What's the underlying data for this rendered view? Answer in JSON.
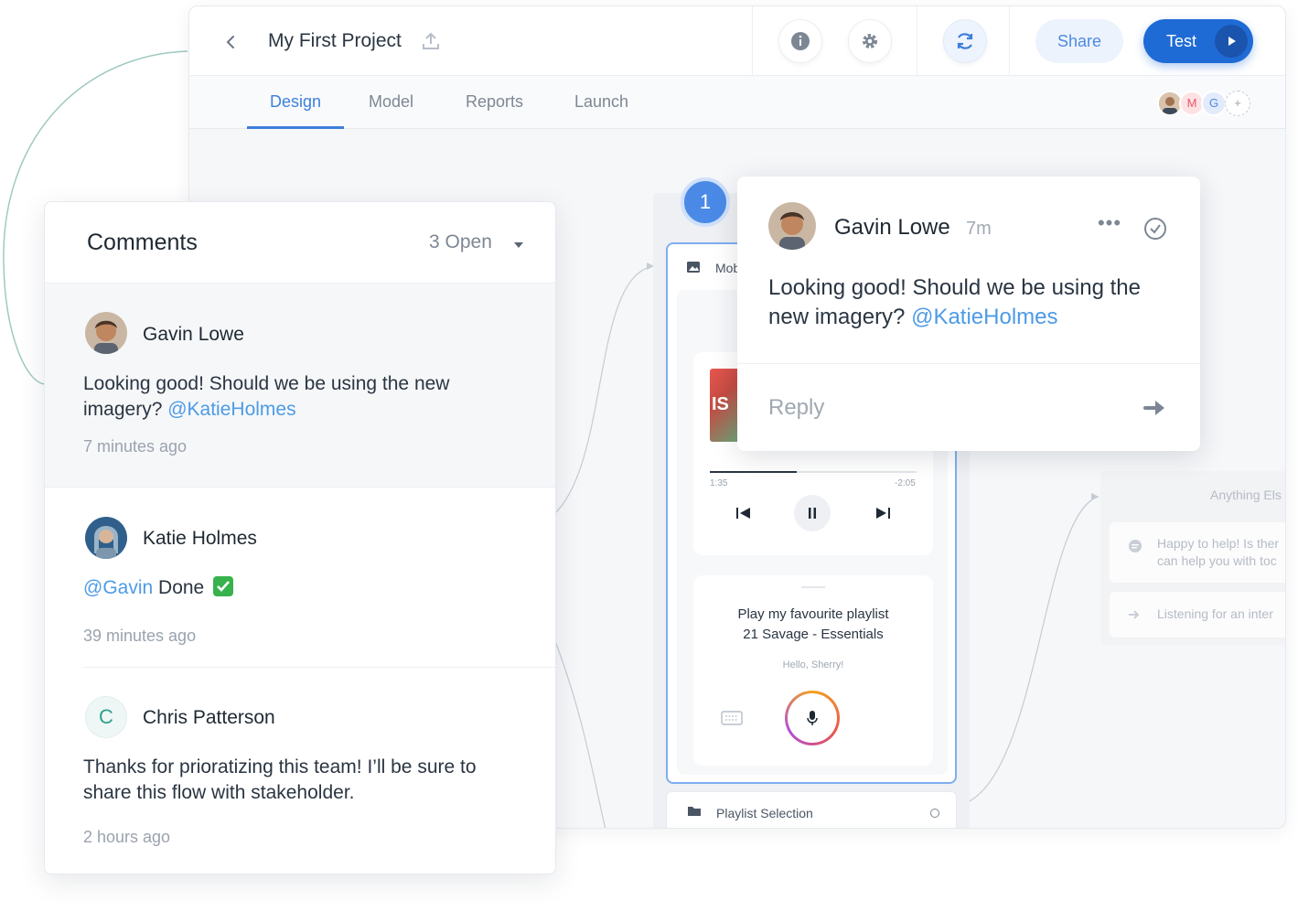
{
  "header": {
    "project_title": "My First Project",
    "share_label": "Share",
    "test_label": "Test"
  },
  "tabs": [
    {
      "label": "Design",
      "active": true
    },
    {
      "label": "Model",
      "active": false
    },
    {
      "label": "Reports",
      "active": false
    },
    {
      "label": "Launch",
      "active": false
    }
  ],
  "collaborators": {
    "initials": [
      "M",
      "G"
    ],
    "add_label": "+"
  },
  "canvas": {
    "step_number": "1",
    "flow_node_label": "Mob",
    "player": {
      "elapsed": "1:35",
      "remaining": "-2:05",
      "progress_fraction": 0.42
    },
    "speech": {
      "line1": "Play my favourite playlist",
      "line2": "21 Savage - Essentials",
      "greeting": "Hello, Sherry!"
    },
    "playlist_node_label": "Playlist Selection",
    "faded_node": {
      "title": "Anything Els",
      "row1_line1": "Happy to help! Is ther",
      "row1_line2": "can help you with toc",
      "row2": "Listening for an inter"
    }
  },
  "popover": {
    "author": "Gavin Lowe",
    "time": "7m",
    "more_label": "•••",
    "message": "Looking good! Should we be using the new imagery?",
    "mention": "@KatieHolmes",
    "reply_placeholder": "Reply"
  },
  "comments": {
    "title": "Comments",
    "filter_label": "3 Open",
    "items": [
      {
        "author": "Gavin Lowe",
        "message": "Looking good! Should we be using the new imagery?",
        "mention": "@KatieHolmes",
        "time": "7 minutes ago"
      },
      {
        "author": "Katie Holmes",
        "mention": "@Gavin",
        "message": "Done",
        "time": "39 minutes ago"
      },
      {
        "author": "Chris Patterson",
        "avatar_initial": "C",
        "message": "Thanks for prioratizing this team! I’ll be sure to share this flow with stakeholder.",
        "time": "2 hours ago"
      }
    ]
  },
  "colors": {
    "accent": "#1f6bd6",
    "tab_active": "#3d7fdc",
    "mention": "#4d9be6",
    "step_badge": "#4a8ae6"
  }
}
